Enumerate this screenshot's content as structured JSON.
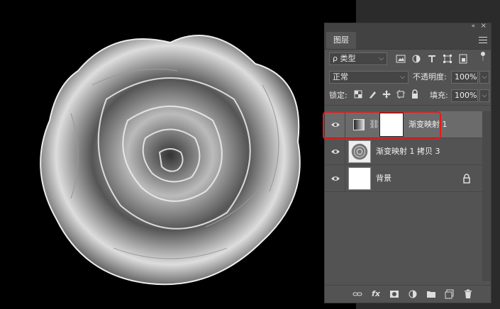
{
  "panel": {
    "tab_label": "图层",
    "collapse_glyph": "«",
    "close_glyph": "×",
    "filter": {
      "search_glyph": "ρ",
      "value": "类型"
    },
    "filter_icons": [
      "image-filter-icon",
      "adjustment-filter-icon",
      "type-filter-icon",
      "shape-filter-icon",
      "smartobject-filter-icon"
    ],
    "blend_mode": "正常",
    "opacity_label": "不透明度:",
    "opacity_value": "100%",
    "lock_label": "锁定:",
    "fill_label": "填充:",
    "fill_value": "100%"
  },
  "layers": [
    {
      "name": "渐变映射 1",
      "type": "adjustment",
      "visible": true,
      "selected": true
    },
    {
      "name": "渐变映射 1 拷贝 3",
      "type": "image",
      "visible": true,
      "selected": false
    },
    {
      "name": "背景",
      "type": "background",
      "visible": true,
      "selected": false,
      "locked": true
    }
  ],
  "footer": {
    "icons": [
      "link-layers-icon",
      "fx-icon",
      "add-mask-icon",
      "new-adjustment-icon",
      "new-group-icon",
      "new-layer-icon",
      "delete-icon"
    ],
    "fx_label": "fx"
  },
  "colors": {
    "highlight": "#e31b1b",
    "panel_bg": "#535353"
  }
}
